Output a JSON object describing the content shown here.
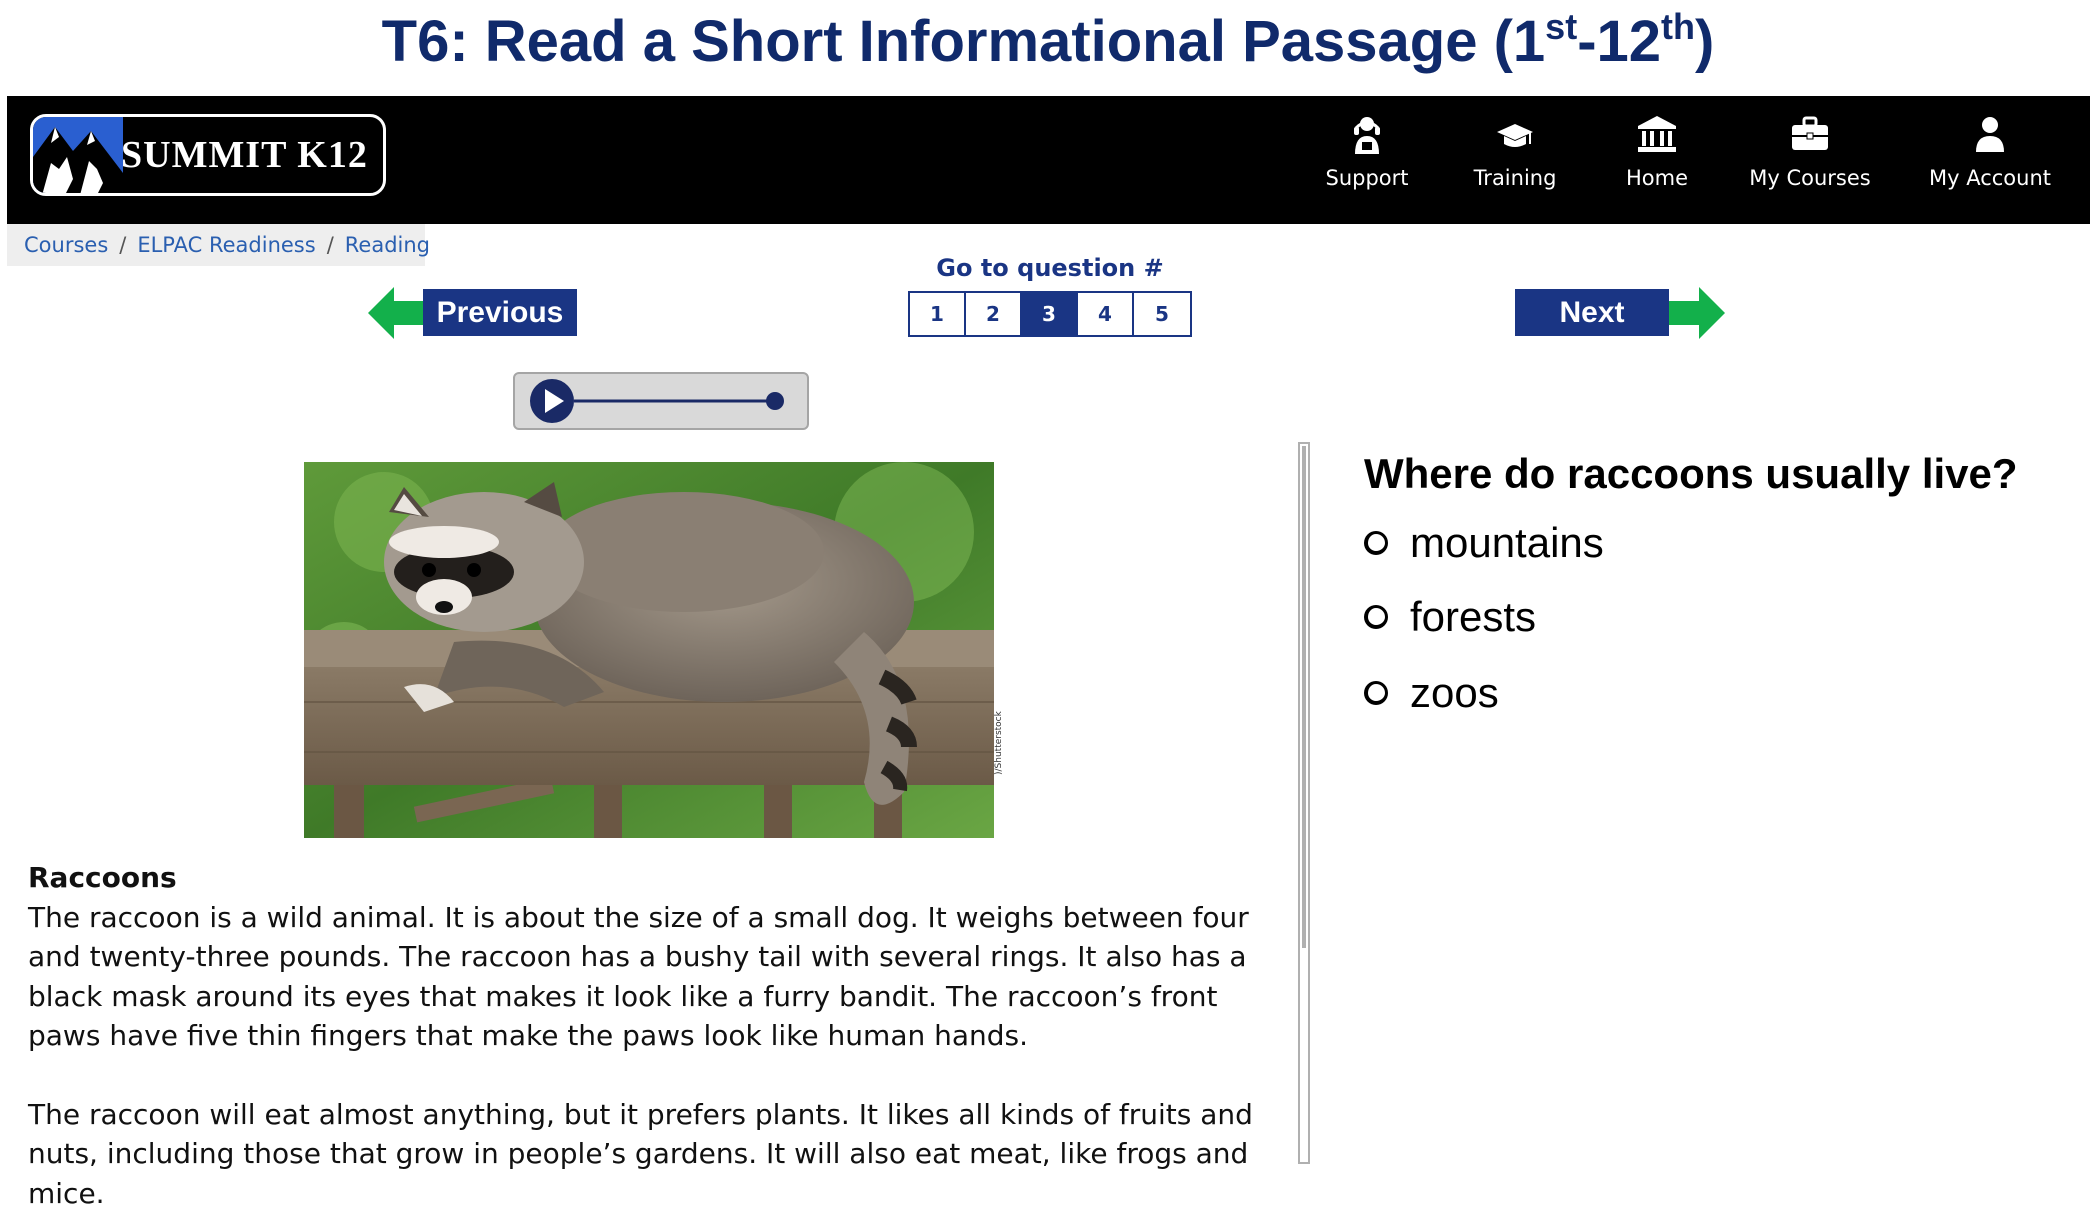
{
  "slide": {
    "title_main": "T6: Read a Short Informational Passage (1",
    "title_sup1": "st",
    "title_mid": "-12",
    "title_sup2": "th",
    "title_end": ")"
  },
  "header": {
    "logo_text": "SUMMIT K12",
    "nav": [
      {
        "label": "Support",
        "icon": "support-person-icon"
      },
      {
        "label": "Training",
        "icon": "graduation-cap-icon"
      },
      {
        "label": "Home",
        "icon": "building-columns-icon"
      },
      {
        "label": "My Courses",
        "icon": "briefcase-icon"
      },
      {
        "label": "My Account",
        "icon": "user-icon"
      }
    ]
  },
  "breadcrumb": [
    "Courses",
    "ELPAC Readiness",
    "Reading"
  ],
  "navigation": {
    "previous_label": "Previous",
    "next_label": "Next",
    "goto_label": "Go to question #",
    "questions": [
      "1",
      "2",
      "3",
      "4",
      "5"
    ],
    "active_question": "3"
  },
  "audio": {
    "icon": "play-icon"
  },
  "image": {
    "credit": ")/Shutterstock"
  },
  "passage": {
    "title": "Raccoons",
    "paragraphs": [
      "The raccoon is a wild animal. It is about the size of a small dog. It weighs between four and twenty-three pounds. The raccoon has a bushy tail with several rings. It also has a black mask around its eyes that makes it look like a furry bandit. The raccoon’s front paws have five thin fingers that make the paws look like human hands.",
      "The raccoon will eat almost anything, but it prefers plants. It likes all kinds of fruits and nuts, including those that grow in people’s gardens. It will also eat meat, like frogs and mice."
    ]
  },
  "question": {
    "text": "Where do raccoons usually live?",
    "options": [
      "mountains",
      "forests",
      "zoos"
    ]
  },
  "colors": {
    "navy": "#1a3584",
    "title_navy": "#102a6b",
    "arrow_green": "#13b04b",
    "link_blue": "#2a5fb0"
  }
}
